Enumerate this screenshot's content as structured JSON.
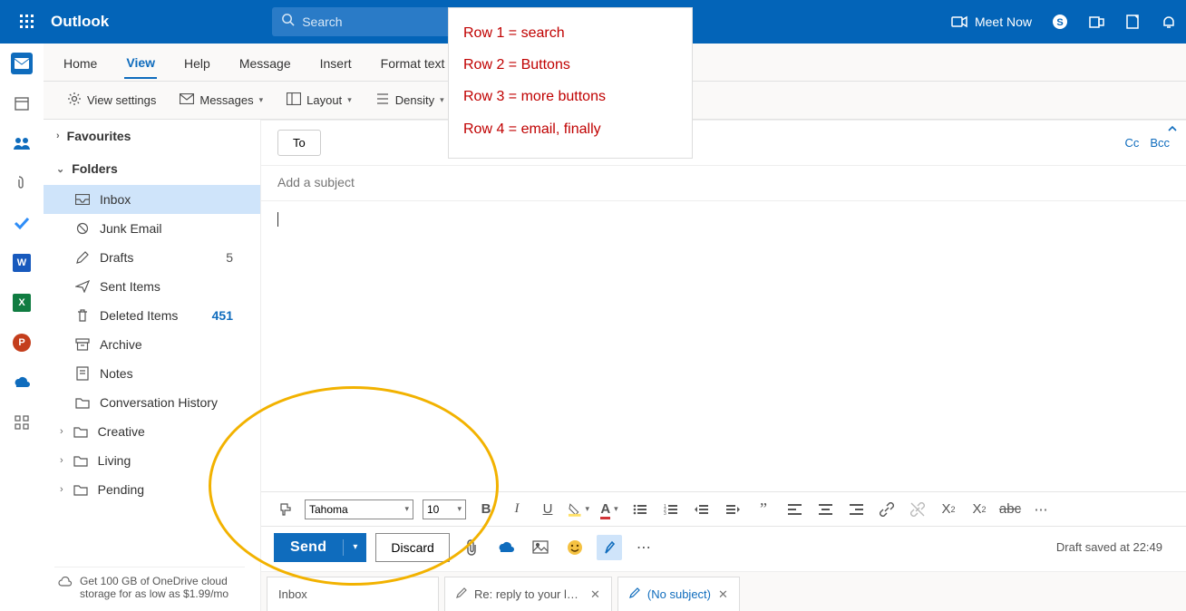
{
  "header": {
    "brand": "Outlook",
    "search_placeholder": "Search",
    "meet_now": "Meet Now"
  },
  "tabs": [
    "Home",
    "View",
    "Help",
    "Message",
    "Insert",
    "Format text"
  ],
  "active_tab": "View",
  "ribbon": {
    "view_settings": "View settings",
    "messages": "Messages",
    "layout": "Layout",
    "density": "Density"
  },
  "nav": {
    "favourites": "Favourites",
    "folders_label": "Folders",
    "items": [
      {
        "icon": "inbox",
        "label": "Inbox",
        "selected": true
      },
      {
        "icon": "junk",
        "label": "Junk Email"
      },
      {
        "icon": "drafts",
        "label": "Drafts",
        "count": "5"
      },
      {
        "icon": "sent",
        "label": "Sent Items"
      },
      {
        "icon": "deleted",
        "label": "Deleted Items",
        "count": "451"
      },
      {
        "icon": "archive",
        "label": "Archive"
      },
      {
        "icon": "notes",
        "label": "Notes"
      },
      {
        "icon": "folder",
        "label": "Conversation History"
      },
      {
        "icon": "folder",
        "label": "Creative",
        "expandable": true
      },
      {
        "icon": "folder",
        "label": "Living",
        "expandable": true
      },
      {
        "icon": "folder",
        "label": "Pending",
        "expandable": true
      }
    ],
    "promo": "Get 100 GB of OneDrive cloud storage for as low as $1.99/mo"
  },
  "compose": {
    "to_label": "To",
    "cc": "Cc",
    "bcc": "Bcc",
    "subject_placeholder": "Add a subject",
    "font_name": "Tahoma",
    "font_size": "10",
    "send": "Send",
    "discard": "Discard",
    "draft_status": "Draft saved at 22:49"
  },
  "bottom_tabs": [
    {
      "label": "Inbox",
      "closable": false
    },
    {
      "label": "Re: reply to your last ...",
      "closable": true,
      "draft": true
    },
    {
      "label": "(No subject)",
      "closable": true,
      "draft": true,
      "active": true
    }
  ],
  "annotation": {
    "row1": "Row 1 = search",
    "row2": "Row 2 = Buttons",
    "row3": "Row 3 = more buttons",
    "row4": "Row 4 = email, finally"
  }
}
